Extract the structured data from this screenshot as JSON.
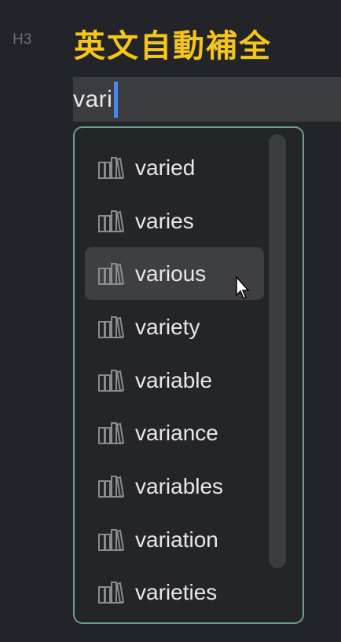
{
  "editor": {
    "gutter_label": "H3",
    "heading": "英文自動補全",
    "typed_text": "vari"
  },
  "autocomplete": {
    "selected_index": 2,
    "items": [
      {
        "label": "varied",
        "icon": "library-books-icon"
      },
      {
        "label": "varies",
        "icon": "library-books-icon"
      },
      {
        "label": "various",
        "icon": "library-books-icon"
      },
      {
        "label": "variety",
        "icon": "library-books-icon"
      },
      {
        "label": "variable",
        "icon": "library-books-icon"
      },
      {
        "label": "variance",
        "icon": "library-books-icon"
      },
      {
        "label": "variables",
        "icon": "library-books-icon"
      },
      {
        "label": "variation",
        "icon": "library-books-icon"
      },
      {
        "label": "varieties",
        "icon": "library-books-icon"
      }
    ]
  },
  "colors": {
    "background": "#222429",
    "heading": "#f5c518",
    "caret": "#4b87ec",
    "popup_border": "#6e9c8e",
    "selected_row": "#3d3f43"
  }
}
